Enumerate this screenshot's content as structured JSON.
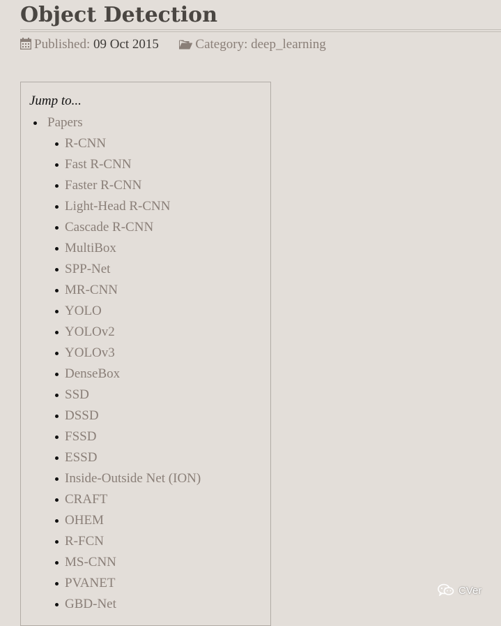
{
  "post": {
    "title": "Object Detection",
    "published_label": "Published:",
    "published_date": "09 Oct 2015",
    "category_label": "Category:",
    "category_value": "deep_learning",
    "icons": {
      "published": "calendar-icon",
      "category": "folder-open-icon"
    }
  },
  "toc": {
    "title": "Jump to...",
    "items": [
      {
        "label": "Papers",
        "children": [
          "R-CNN",
          "Fast R-CNN",
          "Faster R-CNN",
          "Light-Head R-CNN",
          "Cascade R-CNN",
          "MultiBox",
          "SPP-Net",
          "MR-CNN",
          "YOLO",
          "YOLOv2",
          "YOLOv3",
          "DenseBox",
          "SSD",
          "DSSD",
          "FSSD",
          "ESSD",
          "Inside-Outside Net (ION)",
          "CRAFT",
          "OHEM",
          "R-FCN",
          "MS-CNN",
          "PVANET",
          "GBD-Net"
        ]
      }
    ]
  },
  "watermark": {
    "text": "CVer",
    "icon": "wechat-icon"
  },
  "colors": {
    "background": "#e3ded9",
    "link": "#8a7f78",
    "title": "#4a4642"
  }
}
